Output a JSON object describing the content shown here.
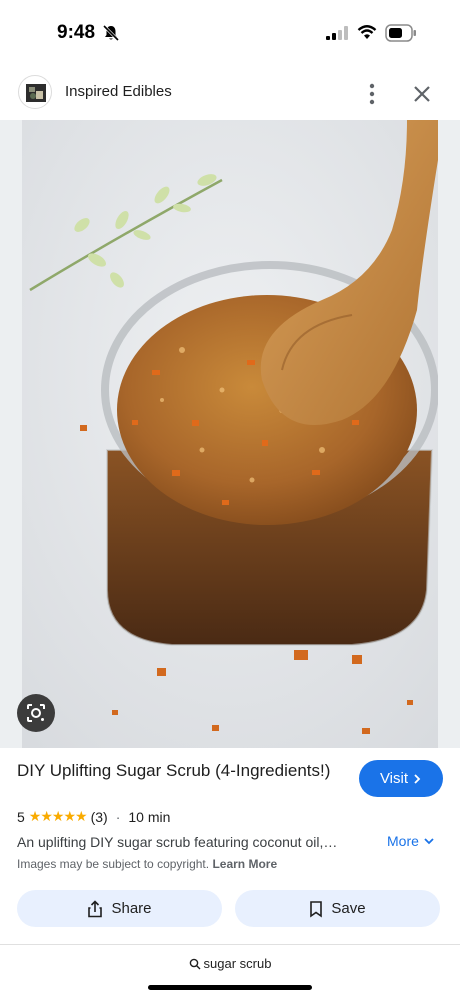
{
  "status_bar": {
    "time": "9:48",
    "icons": [
      "bell-off-icon",
      "signal-icon",
      "wifi-icon",
      "battery-icon"
    ]
  },
  "header": {
    "site_name": "Inspired Edibles",
    "icons": [
      "site-avatar",
      "more-vert-icon",
      "close-icon"
    ]
  },
  "image": {
    "description_icon": "lens-icon"
  },
  "result": {
    "title": "DIY Uplifting Sugar Scrub (4-Ingredients!)",
    "visit_label": "Visit",
    "rating": "5",
    "rating_stars": 5,
    "review_count": "(3)",
    "time": "10 min",
    "description": "An uplifting DIY sugar scrub featuring coconut oil,…",
    "more_label": "More",
    "copyright_text": "Images may be subject to copyright.",
    "learn_more_label": "Learn More"
  },
  "actions": {
    "share_label": "Share",
    "save_label": "Save"
  },
  "query": {
    "text": "sugar scrub"
  },
  "colors": {
    "accent": "#1a73e8",
    "button_bg": "#e8f0fe",
    "star": "#f9ab00"
  }
}
